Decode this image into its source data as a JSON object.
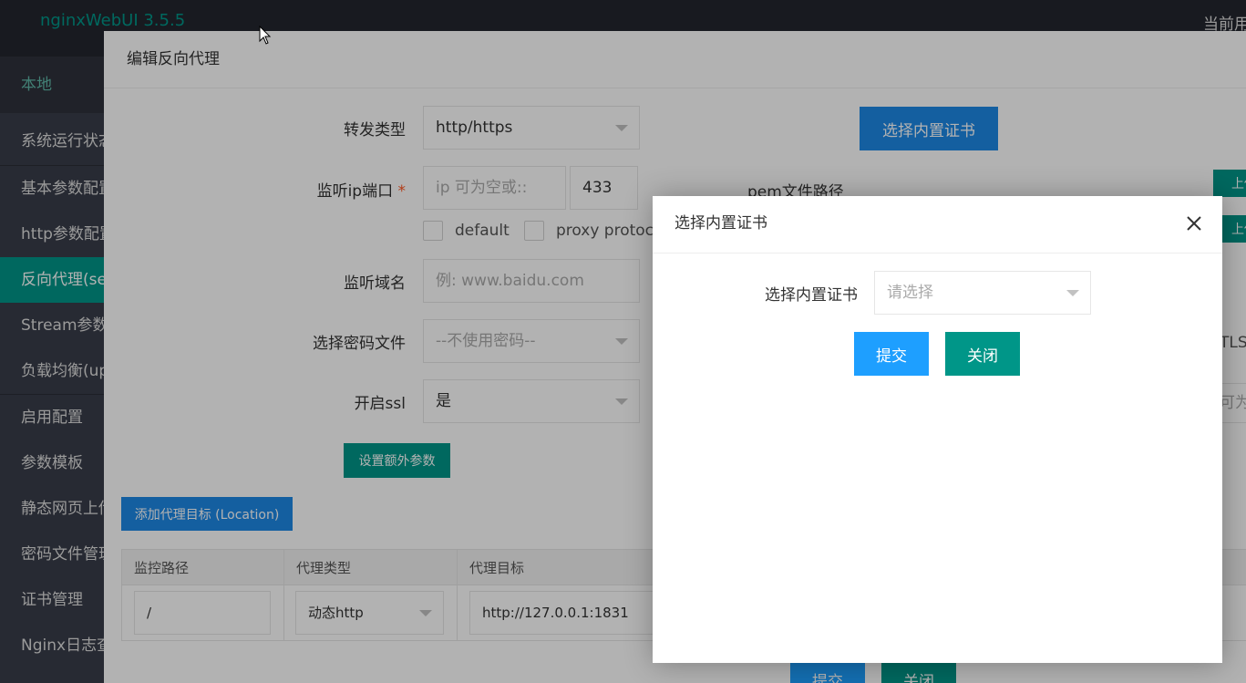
{
  "header": {
    "logo": "nginxWebUI 3.5.5",
    "user": "当前用"
  },
  "sidebar": {
    "items": [
      {
        "label": "本地"
      },
      {
        "label": "系统运行状态"
      },
      {
        "label": "基本参数配置"
      },
      {
        "label": "http参数配置"
      },
      {
        "label": "反向代理(server)"
      },
      {
        "label": "Stream参数配置"
      },
      {
        "label": "负载均衡(upstream)"
      },
      {
        "label": "启用配置"
      },
      {
        "label": "参数模板"
      },
      {
        "label": "静态网页上传"
      },
      {
        "label": "密码文件管理"
      },
      {
        "label": "证书管理"
      },
      {
        "label": "Nginx日志查看"
      }
    ]
  },
  "editor": {
    "title": "编辑反向代理",
    "forward_type_label": "转发类型",
    "forward_type_value": "http/https",
    "listen_label": "监听ip端口",
    "listen_required": "*",
    "ip_placeholder": "ip 可为空或::",
    "port_value": "433",
    "default_label": "default",
    "proxy_protocol_label": "proxy protocol",
    "domain_label": "监听域名",
    "domain_placeholder": "例: www.baidu.com",
    "password_file_label": "选择密码文件",
    "password_file_value": "--不使用密码--",
    "ssl_label": "开启ssl",
    "ssl_value": "是",
    "extra_params_button": "设置额外参数",
    "builtin_cert_button": "选择内置证书",
    "pem_path_label": "pem文件路径",
    "upload_label": "上传",
    "tls_label": "TLS",
    "optional_hint": "可为",
    "add_location_button": "添加代理目标 (Location)",
    "table": {
      "headers": [
        "监控路径",
        "代理类型",
        "代理目标"
      ],
      "rows": [
        {
          "path": "/",
          "type": "动态http",
          "target": "http://127.0.0.1:1831"
        }
      ]
    },
    "submit_button": "提交",
    "close_button": "关闭"
  },
  "dialog": {
    "title": "选择内置证书",
    "field_label": "选择内置证书",
    "placeholder": "请选择",
    "submit_button": "提交",
    "close_button": "关闭"
  },
  "colors": {
    "teal": "#009688",
    "blue": "#1e9fff",
    "header_bg": "#23262e",
    "sidebar_bg": "#393d49"
  }
}
